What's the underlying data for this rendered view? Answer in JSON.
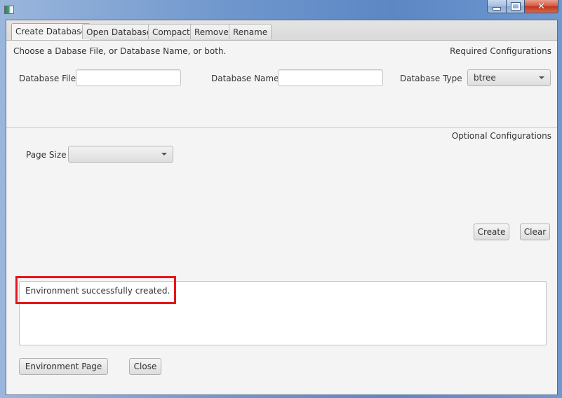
{
  "window": {
    "title": "",
    "controls": {
      "minimize": "minimize",
      "maximize": "maximize",
      "close": "close"
    }
  },
  "tabs": [
    {
      "label": "Create Database",
      "active": true
    },
    {
      "label": "Open Database",
      "active": false
    },
    {
      "label": "Compact",
      "active": false
    },
    {
      "label": "Remove",
      "active": false
    },
    {
      "label": "Rename",
      "active": false
    }
  ],
  "required": {
    "instruction": "Choose a Dabase File, or Database Name, or both.",
    "section_title": "Required Configurations",
    "database_file": {
      "label": "Database File",
      "value": "",
      "placeholder": ""
    },
    "database_name": {
      "label": "Database Name",
      "value": "",
      "placeholder": ""
    },
    "database_type": {
      "label": "Database Type",
      "selected": "btree"
    }
  },
  "optional": {
    "section_title": "Optional Configurations",
    "page_size": {
      "label": "Page Size",
      "selected": ""
    }
  },
  "actions": {
    "create": "Create",
    "clear": "Clear"
  },
  "output": {
    "message": "Environment successfully created.",
    "highlight_color": "#e8141b"
  },
  "footer": {
    "environment_page": "Environment Page",
    "close": "Close"
  }
}
